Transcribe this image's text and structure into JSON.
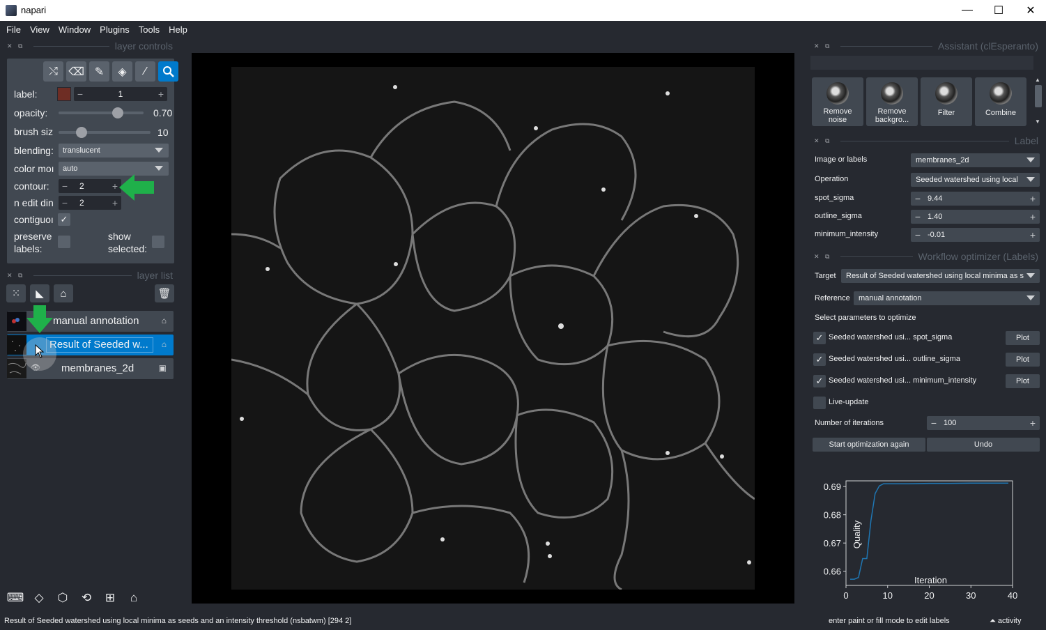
{
  "window": {
    "title": "napari",
    "minimize": "—",
    "maximize": "☐",
    "close": "✕"
  },
  "menu": [
    "File",
    "View",
    "Window",
    "Plugins",
    "Tools",
    "Help"
  ],
  "layer_controls": {
    "dock_title": "layer controls",
    "tools": [
      "shuffle-icon",
      "eraser-icon",
      "brush-icon",
      "fill-icon",
      "picker-icon",
      "zoom-icon"
    ],
    "active_tool": "zoom-icon",
    "label_text": "label:",
    "label_value": "1",
    "label_color": "#6e2d24",
    "opacity_text": "opacity:",
    "opacity_value": "0.70",
    "opacity_fraction": 0.7,
    "brush_text": "brush siz",
    "brush_value": "10",
    "brush_fraction": 0.25,
    "blending_text": "blending:",
    "blending_value": "translucent",
    "colormode_text": "color moı",
    "colormode_value": "auto",
    "contour_text": "contour:",
    "contour_value": "2",
    "ndim_text": "n edit din",
    "ndim_value": "2",
    "contiguous_text": "contiguoı",
    "contiguous_checked": true,
    "preserve_text_1": "preserve",
    "preserve_text_2": "labels:",
    "show_selected_text_1": "show",
    "show_selected_text_2": "selected:"
  },
  "layer_list": {
    "dock_title": "layer list",
    "layers": [
      {
        "name": "manual annotation",
        "type_icon": "labels-icon",
        "selected": false
      },
      {
        "name": "Result of Seeded w...",
        "type_icon": "labels-icon",
        "selected": true
      },
      {
        "name": "membranes_2d",
        "type_icon": "image-icon",
        "selected": false
      }
    ]
  },
  "assistant": {
    "dock_title": "Assistant (clEsperanto)",
    "buttons": [
      {
        "label1": "Remove",
        "label2": "noise"
      },
      {
        "label1": "Remove",
        "label2": "backgro..."
      },
      {
        "label1": "Filter",
        "label2": ""
      },
      {
        "label1": "Combine",
        "label2": ""
      }
    ]
  },
  "label_panel": {
    "dock_title": "Label",
    "image_label": "Image or labels",
    "image_value": "membranes_2d",
    "operation_label": "Operation",
    "operation_value": "Seeded watershed using local",
    "spot_sigma_label": "spot_sigma",
    "spot_sigma_value": "9.44",
    "outline_sigma_label": "outline_sigma",
    "outline_sigma_value": "1.40",
    "min_intensity_label": "minimum_intensity",
    "min_intensity_value": "-0.01"
  },
  "optimizer": {
    "dock_title": "Workflow optimizer (Labels)",
    "target_label": "Target",
    "target_value": "Result of Seeded watershed using local minima as s",
    "reference_label": "Reference",
    "reference_value": "manual annotation",
    "select_text": "Select parameters to optimize",
    "params": [
      {
        "label": "Seeded watershed usi... spot_sigma",
        "checked": true,
        "plot": "Plot"
      },
      {
        "label": "Seeded watershed usi... outline_sigma",
        "checked": true,
        "plot": "Plot"
      },
      {
        "label": "Seeded watershed usi... minimum_intensity",
        "checked": true,
        "plot": "Plot"
      }
    ],
    "live_update_label": "Live-update",
    "live_update_checked": false,
    "iterations_label": "Number of iterations",
    "iterations_value": "100",
    "start_button": "Start optimization again",
    "undo_button": "Undo"
  },
  "chart_data": {
    "type": "line",
    "title": "",
    "xlabel": "Iteration",
    "ylabel": "Quality",
    "xlim": [
      0,
      40
    ],
    "ylim": [
      0.655,
      0.692
    ],
    "xticks": [
      "0",
      "10",
      "20",
      "30",
      "40"
    ],
    "yticks": [
      "0.66",
      "0.67",
      "0.68",
      "0.69"
    ],
    "grid": false,
    "line_color": "#1f77b4",
    "x": [
      1,
      2,
      3,
      4,
      5,
      6,
      7,
      8,
      9,
      10,
      15,
      20,
      25,
      30,
      35,
      39
    ],
    "y": [
      0.6572,
      0.6572,
      0.6578,
      0.6645,
      0.6645,
      0.678,
      0.6875,
      0.6902,
      0.691,
      0.691,
      0.691,
      0.6911,
      0.6911,
      0.6912,
      0.6912,
      0.6912
    ]
  },
  "status": {
    "left": "Result of Seeded watershed using local minima as seeds and an intensity threshold (nsbatwm) [294  2]",
    "right": "enter paint or fill mode to edit labels",
    "activity": "activity"
  }
}
